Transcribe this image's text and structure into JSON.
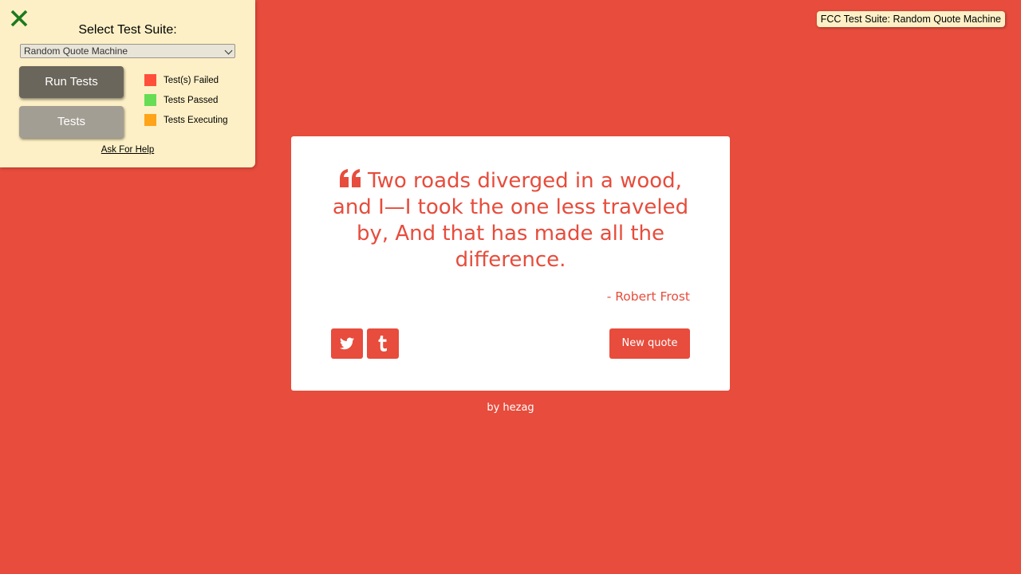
{
  "colors": {
    "background": "#e74c3c",
    "panel": "#fdf0c6",
    "run_button": "#6b665b",
    "tests_button": "#a39e93",
    "failed": "#ff4f3a",
    "passed": "#66dd55",
    "executing": "#ffa319",
    "close_icon": "#1d7a1d"
  },
  "test_panel": {
    "close_icon": "close-icon",
    "title": "Select Test Suite:",
    "select_value": "Random Quote Machine",
    "run_tests_label": "Run Tests",
    "tests_label": "Tests",
    "legend": [
      {
        "label": "Test(s) Failed",
        "color": "#ff4f3a"
      },
      {
        "label": "Tests Passed",
        "color": "#66dd55"
      },
      {
        "label": "Tests Executing",
        "color": "#ffa319"
      }
    ],
    "help_link": "Ask For Help"
  },
  "badge": {
    "label": "FCC Test Suite: Random Quote Machine"
  },
  "quote": {
    "icon": "quote-left-icon",
    "text": "Two roads diverged in a wood, and I—I took the one less traveled by, And that has made all the difference.",
    "author": "- Robert Frost"
  },
  "buttons": {
    "twitter_icon": "twitter-icon",
    "tumblr_icon": "tumblr-icon",
    "new_quote": "New quote"
  },
  "footer": {
    "prefix": "by",
    "author_link": "hezag"
  }
}
